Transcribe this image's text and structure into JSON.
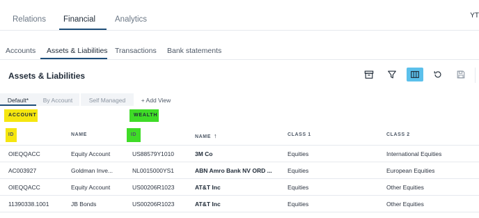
{
  "topnav": {
    "tabs": [
      {
        "label": "Relations"
      },
      {
        "label": "Financial"
      },
      {
        "label": "Analytics"
      }
    ],
    "user_initials": "YT"
  },
  "subnav": {
    "tabs": [
      {
        "label": "Accounts"
      },
      {
        "label": "Assets & Liabilities"
      },
      {
        "label": "Transactions"
      },
      {
        "label": "Bank statements"
      }
    ]
  },
  "page_title": "Assets & Liabilities",
  "toolbar": {
    "icons": [
      "archive-icon",
      "filter-icon",
      "columns-icon",
      "refresh-icon",
      "save-icon"
    ],
    "active_color": "#5bc0eb"
  },
  "views": {
    "default": "Default*",
    "by_account": "By Account",
    "self_managed": "Self Managed",
    "add": "+ Add View"
  },
  "groups": {
    "account": {
      "label": "ACCOUNT",
      "color": "#f5e60f"
    },
    "wealth": {
      "label": "WEALTH",
      "color": "#3fdc27"
    }
  },
  "columns": {
    "id_account": "ID",
    "name_account": "NAME",
    "id_wealth": "ID",
    "name_wealth": "NAME",
    "class1": "CLASS 1",
    "class2": "CLASS 2"
  },
  "rows": [
    {
      "acc_id": "OIEQQACC",
      "acc_name": "Equity Account",
      "w_id": "US88579Y1010",
      "w_name": "3M Co",
      "class1": "Equities",
      "class2": "International Equities"
    },
    {
      "acc_id": "AC003927",
      "acc_name": "Goldman Inve...",
      "w_id": "NL0015000YS1",
      "w_name": "ABN Amro Bank NV ORD ...",
      "class1": "Equities",
      "class2": "European Equities"
    },
    {
      "acc_id": "OIEQQACC",
      "acc_name": "Equity Account",
      "w_id": "US00206R1023",
      "w_name": "AT&T Inc",
      "class1": "Equities",
      "class2": "Other Equities"
    },
    {
      "acc_id": "11390338.1001",
      "acc_name": "JB Bonds",
      "w_id": "US00206R1023",
      "w_name": "AT&T Inc",
      "class1": "Equities",
      "class2": "Other Equities"
    }
  ]
}
